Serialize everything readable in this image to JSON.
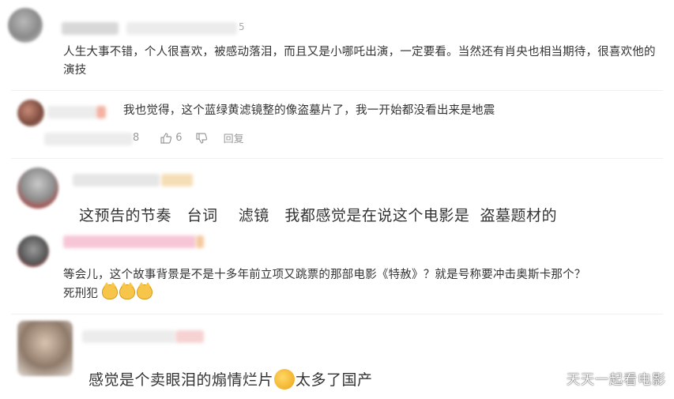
{
  "comments": [
    {
      "text": "人生大事不错，个人很喜欢，被感动落泪，而且又是小哪吒出演，一定要看。当然还有肖央也相当期待，很喜欢他的演技",
      "name_partial": "5"
    },
    {
      "text": "我也觉得，这个蓝绿黄滤镜整的像盗墓片了，我一开始都没看出来是地震",
      "time_partial": "8",
      "likes": "6",
      "reply_label": "回复"
    },
    {
      "text": "这预告的节奏   台词    滤镜   我都感觉是在说这个电影是  盗墓题材的"
    },
    {
      "text_line1": "等会儿，这个故事背景是不是十多年前立项又跳票的那部电影《特赦》？就是号称要冲击奥斯卡那个？",
      "text_line2": "死刑犯"
    },
    {
      "text_before": "感觉是个卖眼泪的煽情烂片",
      "text_after": "太多了国产"
    }
  ],
  "watermark": "天天一起看电影",
  "colors": {
    "text": "#333333",
    "meta": "#999999",
    "accent": "#e8543c"
  },
  "icons": [
    "thumbs-up-icon",
    "thumbs-down-icon",
    "cat-emoji-icon",
    "pick-nose-emoji-icon"
  ]
}
